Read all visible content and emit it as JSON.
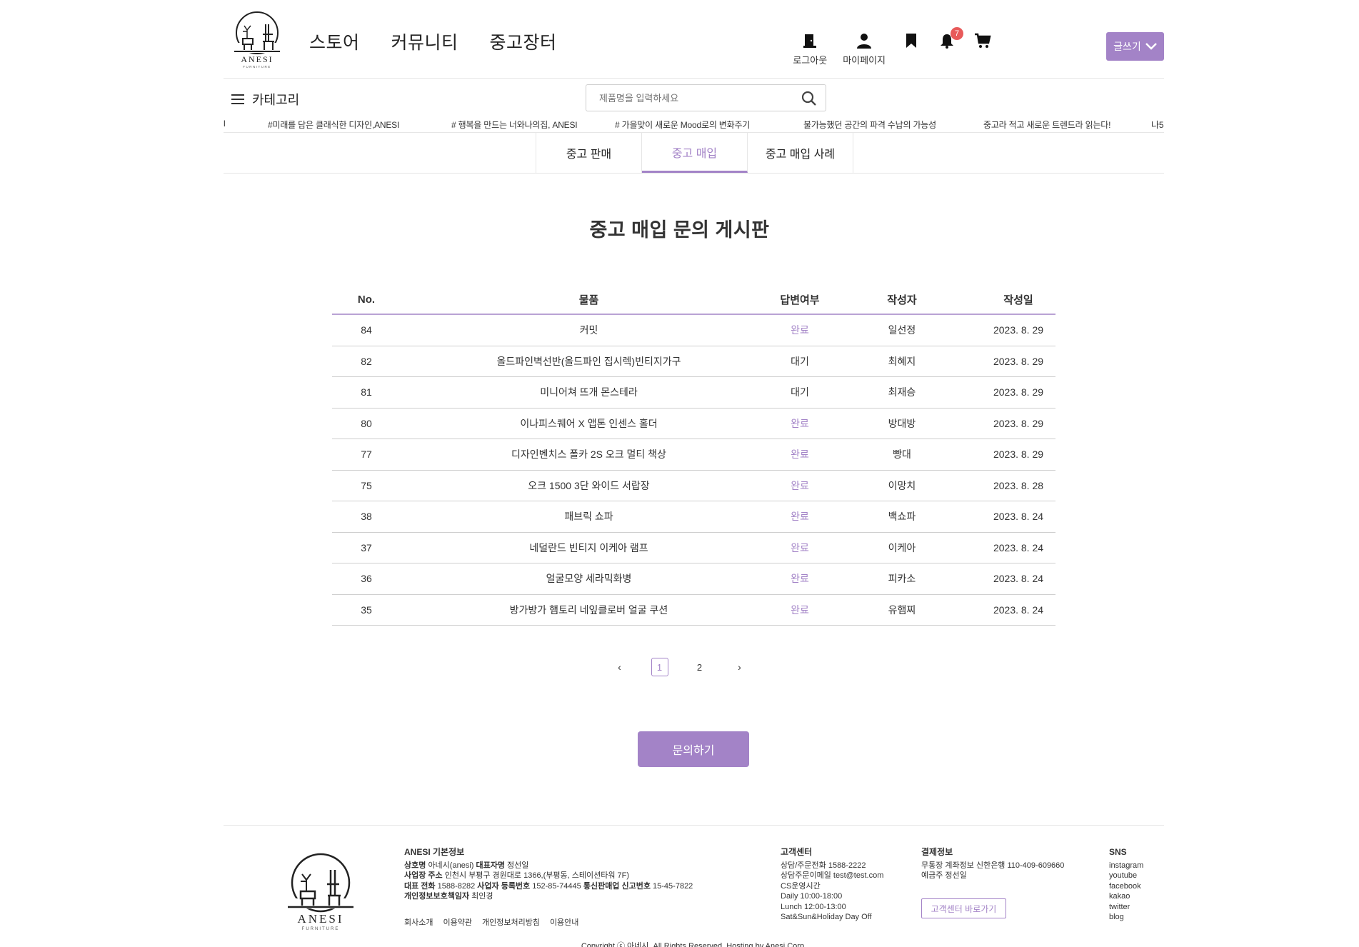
{
  "brand": {
    "name": "ANESI",
    "sub": "FURNITURE"
  },
  "nav": [
    "스토어",
    "커뮤니티",
    "중고장터"
  ],
  "util": {
    "logout": "로그아웃",
    "mypage": "마이페이지",
    "notif_count": "7",
    "write_label": "글쓰기"
  },
  "category_label": "카테고리",
  "search": {
    "placeholder": "제품명을 입력하세요"
  },
  "ticker": [
    "l",
    "#미래를 담은 클래식한 디자인,ANESI",
    "# 행복을 만드는 너와나의집, ANESI",
    "# 가을맞이 새로운 Mood로의 변화주기",
    "불가능했던 공간의 파격 수납의 가능성",
    "중고라 적고 새로운 트렌드라 읽는다!",
    "나5"
  ],
  "tabs": [
    "중고 판매",
    "중고 매입",
    "중고 매입 사례"
  ],
  "active_tab": 1,
  "page_title": "중고 매입 문의 게시판",
  "table": {
    "headers": [
      "No.",
      "물품",
      "답변여부",
      "작성자",
      "작성일"
    ],
    "rows": [
      [
        "84",
        "커밋",
        "완료",
        "일선정",
        "2023. 8. 29"
      ],
      [
        "82",
        "올드파인벽선반(올드파인 집시렉)빈티지가구",
        "대기",
        "최혜지",
        "2023. 8. 29"
      ],
      [
        "81",
        "미니어쳐 뜨개 몬스테라",
        "대기",
        "최재승",
        "2023. 8. 29"
      ],
      [
        "80",
        "이나피스퀘어 X 앱톤 인센스 홀더",
        "완료",
        "방대방",
        "2023. 8. 29"
      ],
      [
        "77",
        "디자인벤치스 폴카 2S 오크 멀티 책상",
        "완료",
        "빵대",
        "2023. 8. 29"
      ],
      [
        "75",
        "오크 1500 3단 와이드 서랍장",
        "완료",
        "이망치",
        "2023. 8. 28"
      ],
      [
        "38",
        "패브릭 쇼파",
        "완료",
        "백쇼파",
        "2023. 8. 24"
      ],
      [
        "37",
        "네덜란드 빈티지 이케아 램프",
        "완료",
        "이케아",
        "2023. 8. 24"
      ],
      [
        "36",
        "얼굴모양 세라믹화병",
        "완료",
        "피카소",
        "2023. 8. 24"
      ],
      [
        "35",
        "방가방가 햄토리 네잎클로버 얼굴 쿠션",
        "완료",
        "유햄찌",
        "2023. 8. 24"
      ]
    ]
  },
  "pagination": {
    "prev": "‹",
    "pages": [
      "1",
      "2"
    ],
    "current": "1",
    "next": "›"
  },
  "inquire_button": "문의하기",
  "footer": {
    "info_title": "ANESI 기본정보",
    "info_lines": [
      {
        "k1": "상호명",
        "v1": "아네시(anesi)",
        "k2": "대표자명",
        "v2": "정선일"
      },
      {
        "k1": "사업장 주소",
        "v1": "인천시 부평구 경원대로 1366,(부평동, 스테이션타워 7F)",
        "k2": "",
        "v2": ""
      },
      {
        "k1": "대표 전화",
        "v1": "1588-8282",
        "k2": "사업자 등록번호",
        "v2": "152-85-74445",
        "k3": "통신판매업 신고번호",
        "v3": "15-45-7822"
      },
      {
        "k1": "개인정보보호책임자",
        "v1": "최인경",
        "k2": "",
        "v2": ""
      }
    ],
    "links": [
      "회사소개",
      "이용약관",
      "개인정보처리방침",
      "이용안내"
    ],
    "cs_title": "고객센터",
    "cs_lines": [
      "상담/주문전화 1588-2222",
      "상담주문이메일 test@test.com",
      "CS운영시간",
      "Daily 10:00-18:00",
      "Lunch 12:00-13:00",
      "Sat&Sun&Holiday Day Off"
    ],
    "pay_title": "결제정보",
    "pay_lines": [
      "무통장 계좌정보 신한은행 110-409-609660",
      "예금주 정선일"
    ],
    "cs_button": "고객센터 바로가기",
    "sns_title": "SNS",
    "sns": [
      "instagram",
      "youtube",
      "facebook",
      "kakao",
      "twitter",
      "blog"
    ],
    "copyright": "Copyright ⓒ 아네시. All Rights Reserved. Hosting by Anesi Corp."
  },
  "colors": {
    "accent": "#a383c7",
    "badge": "#e85a5a"
  }
}
